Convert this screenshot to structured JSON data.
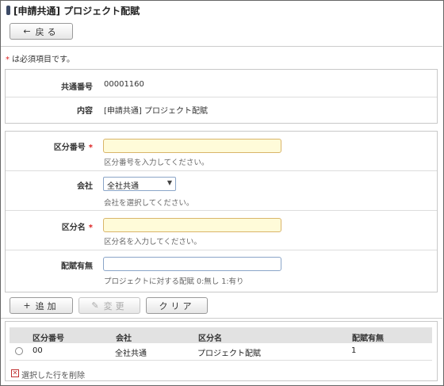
{
  "header": {
    "title": "[申請共通] プロジェクト配賦"
  },
  "toolbar": {
    "back_label": "戻る"
  },
  "required_note": {
    "star": "*",
    "text": "は必須項目です。"
  },
  "info": {
    "rows": [
      {
        "label": "共通番号",
        "value": "00001160"
      },
      {
        "label": "内容",
        "value": "[申請共通] プロジェクト配賦"
      }
    ]
  },
  "form": {
    "division_code": {
      "label": "区分番号",
      "required": "*",
      "value": "",
      "hint": "区分番号を入力してください。"
    },
    "company": {
      "label": "会社",
      "selected": "全社共通",
      "hint": "会社を選択してください。"
    },
    "division_name": {
      "label": "区分名",
      "required": "*",
      "value": "",
      "hint": "区分名を入力してください。"
    },
    "allocation": {
      "label": "配賦有無",
      "value": "",
      "hint": "プロジェクトに対する配賦 0:無し 1:有り"
    }
  },
  "actions": {
    "add_label": "追加",
    "change_label": "変更",
    "clear_label": "クリア"
  },
  "list": {
    "headers": [
      "区分番号",
      "会社",
      "区分名",
      "配賦有無"
    ],
    "rows": [
      {
        "code": "00",
        "company": "全社共通",
        "name": "プロジェクト配賦",
        "allocation": "1"
      }
    ],
    "delete_label": "選択した行を削除"
  },
  "colors": {
    "required": "#dd2222",
    "input_required_bg": "#fffbd9",
    "title_mark": "#3c4a66"
  }
}
